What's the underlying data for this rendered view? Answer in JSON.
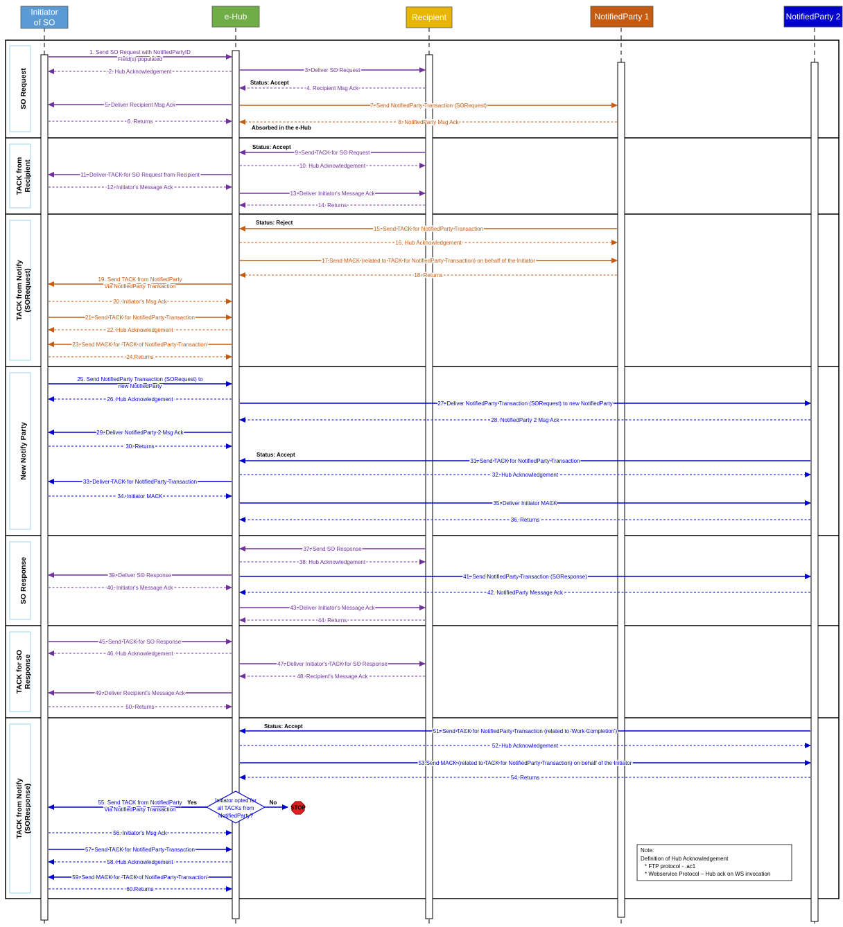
{
  "colors": {
    "purple": "#7030a0",
    "orange": "#c55a11",
    "blue": "#0000cc",
    "reject": "#ff0000"
  },
  "participants": [
    {
      "id": "initiator",
      "label": "Initiator of SO",
      "lines": [
        "Initiator",
        "of SO"
      ],
      "color": "#5b9bd5"
    },
    {
      "id": "ehub",
      "label": "e-Hub",
      "lines": [
        "e-Hub"
      ],
      "color": "#70ad47"
    },
    {
      "id": "recipient",
      "label": "Recipient",
      "lines": [
        "Recipient"
      ],
      "color": "#e8b600"
    },
    {
      "id": "np1",
      "label": "NotifiedParty 1",
      "lines": [
        "NotifiedParty 1"
      ],
      "color": "#c55a11"
    },
    {
      "id": "np2",
      "label": "NotifiedParty 2",
      "lines": [
        "NotifiedParty 2"
      ],
      "color": "#0000cc"
    }
  ],
  "sections": [
    {
      "name": "SO Request",
      "lines": [
        "SO Request"
      ]
    },
    {
      "name": "TACK from Recipient",
      "lines": [
        "TACK from",
        "Recipient"
      ]
    },
    {
      "name": "TACK from Notify (SORequest)",
      "lines": [
        "TACK from Notify",
        "(SORequest)"
      ]
    },
    {
      "name": "New Notify Party",
      "lines": [
        "New Notify Party"
      ]
    },
    {
      "name": "SO Response",
      "lines": [
        "SO Response"
      ]
    },
    {
      "name": "TACK for SO Response",
      "lines": [
        "TACK for SO",
        "Response"
      ]
    },
    {
      "name": "TACK from Notify (SOResponse)",
      "lines": [
        "TACK from Notify",
        "(SOResponse)"
      ]
    }
  ],
  "messages": [
    {
      "lines": [
        "1. Send SO Request with NotifiedPartyID",
        "Field(s) populated"
      ],
      "from": "initiator",
      "to": "ehub",
      "dashed": false,
      "color": "purple"
    },
    {
      "lines": [
        "2. Hub Acknowledgement"
      ],
      "from": "ehub",
      "to": "initiator",
      "dashed": true,
      "color": "purple"
    },
    {
      "lines": [
        "3. Deliver SO Request"
      ],
      "from": "ehub",
      "to": "recipient",
      "dashed": false,
      "color": "purple"
    },
    {
      "lines": [
        "4. Recipient Msg Ack"
      ],
      "from": "recipient",
      "to": "ehub",
      "dashed": true,
      "color": "purple"
    },
    {
      "lines": [
        "5. Deliver Recipient Msg Ack"
      ],
      "from": "ehub",
      "to": "initiator",
      "dashed": false,
      "color": "purple"
    },
    {
      "lines": [
        "6. Returns"
      ],
      "from": "initiator",
      "to": "ehub",
      "dashed": true,
      "color": "purple"
    },
    {
      "lines": [
        "7. Send NotifiedParty Transaction (SORequest)"
      ],
      "from": "ehub",
      "to": "np1",
      "dashed": false,
      "color": "orange"
    },
    {
      "lines": [
        "8. NotifiedParty Msg Ack"
      ],
      "from": "np1",
      "to": "ehub",
      "dashed": true,
      "color": "orange"
    },
    {
      "lines": [
        "9. Send TACK for SO Request"
      ],
      "from": "recipient",
      "to": "ehub",
      "dashed": false,
      "color": "purple"
    },
    {
      "lines": [
        "10. Hub Acknowledgement"
      ],
      "from": "ehub",
      "to": "recipient",
      "dashed": true,
      "color": "purple"
    },
    {
      "lines": [
        "11. Deliver TACK for SO Request from Recipient"
      ],
      "from": "ehub",
      "to": "initiator",
      "dashed": false,
      "color": "purple"
    },
    {
      "lines": [
        "12. Initiator's Message Ack"
      ],
      "from": "initiator",
      "to": "ehub",
      "dashed": true,
      "color": "purple"
    },
    {
      "lines": [
        "13. Deliver Initiator's Message Ack"
      ],
      "from": "ehub",
      "to": "recipient",
      "dashed": false,
      "color": "purple"
    },
    {
      "lines": [
        "14. Returns"
      ],
      "from": "recipient",
      "to": "ehub",
      "dashed": true,
      "color": "purple"
    },
    {
      "lines": [
        "15. Send TACK for NotifiedParty Transaction"
      ],
      "from": "np1",
      "to": "ehub",
      "dashed": false,
      "color": "orange"
    },
    {
      "lines": [
        "16. Hub Acknowledgement"
      ],
      "from": "ehub",
      "to": "np1",
      "dashed": true,
      "color": "orange"
    },
    {
      "lines": [
        "17.Send MACK (related to TACK for NotifiedParty Transaction) on behalf of the Initiator"
      ],
      "from": "ehub",
      "to": "np1",
      "dashed": false,
      "color": "orange"
    },
    {
      "lines": [
        "18. Returns"
      ],
      "from": "np1",
      "to": "ehub",
      "dashed": true,
      "color": "orange"
    },
    {
      "lines": [
        "19. Send TACK from NotifiedParty",
        "Via NotifiedParty Transaction"
      ],
      "from": "ehub",
      "to": "initiator",
      "dashed": false,
      "color": "orange"
    },
    {
      "lines": [
        "20. Initiator's Msg Ack"
      ],
      "from": "initiator",
      "to": "ehub",
      "dashed": true,
      "color": "orange"
    },
    {
      "lines": [
        "21. Send TACK for NotifiedParty Transaction"
      ],
      "from": "initiator",
      "to": "ehub",
      "dashed": false,
      "color": "orange"
    },
    {
      "lines": [
        "22. Hub Acknowledgement"
      ],
      "from": "ehub",
      "to": "initiator",
      "dashed": true,
      "color": "orange"
    },
    {
      "lines": [
        "23. Send MACK for 'TACK of NotifiedParty Transaction'"
      ],
      "from": "ehub",
      "to": "initiator",
      "dashed": false,
      "color": "orange"
    },
    {
      "lines": [
        "24.Returns"
      ],
      "from": "initiator",
      "to": "ehub",
      "dashed": true,
      "color": "orange"
    },
    {
      "lines": [
        "25. Send NotifiedParty Transaction (SORequest) to",
        "new NotifiedParty"
      ],
      "from": "initiator",
      "to": "ehub",
      "dashed": false,
      "color": "blue"
    },
    {
      "lines": [
        "26. Hub Acknowledgement"
      ],
      "from": "ehub",
      "to": "initiator",
      "dashed": true,
      "color": "blue"
    },
    {
      "lines": [
        "27. Deliver NotifiedParty Transaction (SORequest) to new NotifiedParty"
      ],
      "from": "ehub",
      "to": "np2",
      "dashed": false,
      "color": "blue"
    },
    {
      "lines": [
        "28. NotifiedParty 2 Msg Ack"
      ],
      "from": "np2",
      "to": "ehub",
      "dashed": true,
      "color": "blue"
    },
    {
      "lines": [
        "29. Deliver NotifiedParty 2 Msg Ack"
      ],
      "from": "ehub",
      "to": "initiator",
      "dashed": false,
      "color": "blue"
    },
    {
      "lines": [
        "30. Returns"
      ],
      "from": "initiator",
      "to": "ehub",
      "dashed": true,
      "color": "blue"
    },
    {
      "lines": [
        "31. Send TACK for NotifiedParty Transaction"
      ],
      "from": "np2",
      "to": "ehub",
      "dashed": false,
      "color": "blue"
    },
    {
      "lines": [
        "32. Hub Acknowledgement"
      ],
      "from": "ehub",
      "to": "np2",
      "dashed": true,
      "color": "blue"
    },
    {
      "lines": [
        "33. Deliver TACK for NotifiedParty Transaction"
      ],
      "from": "ehub",
      "to": "initiator",
      "dashed": false,
      "color": "blue"
    },
    {
      "lines": [
        "34. Initiator MACK"
      ],
      "from": "initiator",
      "to": "ehub",
      "dashed": true,
      "color": "blue"
    },
    {
      "lines": [
        "35. Deliver Initiator MACK"
      ],
      "from": "ehub",
      "to": "np2",
      "dashed": false,
      "color": "blue"
    },
    {
      "lines": [
        "36. Returns"
      ],
      "from": "np2",
      "to": "ehub",
      "dashed": true,
      "color": "blue"
    },
    {
      "lines": [
        "37. Send SO Response"
      ],
      "from": "recipient",
      "to": "ehub",
      "dashed": false,
      "color": "purple"
    },
    {
      "lines": [
        "38. Hub Acknowledgement"
      ],
      "from": "ehub",
      "to": "recipient",
      "dashed": true,
      "color": "purple"
    },
    {
      "lines": [
        "39. Deliver SO Response"
      ],
      "from": "ehub",
      "to": "initiator",
      "dashed": false,
      "color": "purple"
    },
    {
      "lines": [
        "40. Initiator's Message Ack"
      ],
      "from": "initiator",
      "to": "ehub",
      "dashed": true,
      "color": "purple"
    },
    {
      "lines": [
        "41. Send NotifiedParty Transaction (SOResponse)"
      ],
      "from": "ehub",
      "to": "np2",
      "dashed": false,
      "color": "blue"
    },
    {
      "lines": [
        "42. NotifiedParty Message Ack"
      ],
      "from": "np2",
      "to": "ehub",
      "dashed": true,
      "color": "blue"
    },
    {
      "lines": [
        "43. Deliver Initiator's Message Ack"
      ],
      "from": "ehub",
      "to": "recipient",
      "dashed": false,
      "color": "purple"
    },
    {
      "lines": [
        "44. Returns"
      ],
      "from": "recipient",
      "to": "ehub",
      "dashed": true,
      "color": "purple"
    },
    {
      "lines": [
        "45. Send TACK for SO Response"
      ],
      "from": "initiator",
      "to": "ehub",
      "dashed": false,
      "color": "purple"
    },
    {
      "lines": [
        "46. Hub Acknowledgement"
      ],
      "from": "ehub",
      "to": "initiator",
      "dashed": true,
      "color": "purple"
    },
    {
      "lines": [
        "47. Deliver Initiator's TACK for SO Response"
      ],
      "from": "ehub",
      "to": "recipient",
      "dashed": false,
      "color": "purple"
    },
    {
      "lines": [
        "48. Recipient's Message Ack"
      ],
      "from": "recipient",
      "to": "ehub",
      "dashed": true,
      "color": "purple"
    },
    {
      "lines": [
        "49. Deliver Recipient's Message Ack"
      ],
      "from": "ehub",
      "to": "initiator",
      "dashed": false,
      "color": "purple"
    },
    {
      "lines": [
        "50. Returns"
      ],
      "from": "initiator",
      "to": "ehub",
      "dashed": true,
      "color": "purple"
    },
    {
      "lines": [
        "51. Send TACK for NotifiedParty Transaction (related to 'Work Completion')"
      ],
      "from": "np2",
      "to": "ehub",
      "dashed": false,
      "color": "blue"
    },
    {
      "lines": [
        "52. Hub Acknowledgement"
      ],
      "from": "ehub",
      "to": "np2",
      "dashed": true,
      "color": "blue"
    },
    {
      "lines": [
        "53.Send MACK (related to TACK for NotifiedParty Transaction) on behalf of the Initiator"
      ],
      "from": "ehub",
      "to": "np2",
      "dashed": false,
      "color": "blue"
    },
    {
      "lines": [
        "54. Returns"
      ],
      "from": "np2",
      "to": "ehub",
      "dashed": true,
      "color": "blue"
    },
    {
      "lines": [
        "55. Send TACK from NotifiedParty",
        "Via NotifiedParty Transaction"
      ],
      "from": "ehub",
      "to": "initiator",
      "dashed": false,
      "color": "blue"
    },
    {
      "lines": [
        "56. Initiator's Msg Ack"
      ],
      "from": "initiator",
      "to": "ehub",
      "dashed": true,
      "color": "blue"
    },
    {
      "lines": [
        "57. Send TACK for NotifiedParty Transaction"
      ],
      "from": "initiator",
      "to": "ehub",
      "dashed": false,
      "color": "blue"
    },
    {
      "lines": [
        "58. Hub Acknowledgement"
      ],
      "from": "ehub",
      "to": "initiator",
      "dashed": true,
      "color": "blue"
    },
    {
      "lines": [
        "59. Send MACK for 'TACK of NotifiedParty Transaction'"
      ],
      "from": "ehub",
      "to": "initiator",
      "dashed": false,
      "color": "blue"
    },
    {
      "lines": [
        "60.Returns"
      ],
      "from": "initiator",
      "to": "ehub",
      "dashed": true,
      "color": "blue"
    }
  ],
  "annotations": [
    {
      "text": "Status: Accept",
      "color": "#000000"
    },
    {
      "text": "Absorbed in the e-Hub",
      "color": "#000000"
    },
    {
      "text": "Status: Accept",
      "color": "#000000"
    },
    {
      "text": "Status: Reject",
      "color": "#ff0000"
    },
    {
      "text": "Status: Accept",
      "color": "#000000"
    },
    {
      "text": "Status: Accept",
      "color": "#000000"
    }
  ],
  "decision": {
    "lines": [
      "Initiator opted for",
      "all TACKs from",
      "NotifiedParty?"
    ],
    "yes_label": "Yes",
    "no_label": "No",
    "stop_label": "STOP"
  },
  "note": {
    "lines": [
      "Note:",
      "Definition of Hub Acknowledgement",
      "* FTP protocol - .ac1",
      "* Webservice Protocol – Hub ack on WS invocation"
    ]
  }
}
